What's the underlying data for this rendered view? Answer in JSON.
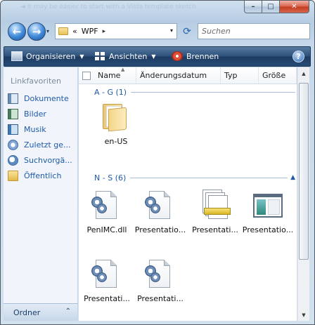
{
  "window": {
    "title_faint": "◄ It may be easier to start with a Vista template sketch",
    "caption": {
      "minimize": "–",
      "maximize": "□",
      "close": "✕"
    }
  },
  "address": {
    "crumb_prefix": "«",
    "path": "WPF",
    "separator": "▸",
    "dropdown": "▾",
    "search_placeholder": "Suchen"
  },
  "nav_buttons": {
    "back": "←",
    "forward": "→",
    "history": "▾"
  },
  "toolbar": {
    "organize": "Organisieren",
    "views": "Ansichten",
    "burn": "Brennen",
    "dropdown_arrow": "▼",
    "help": "?"
  },
  "navpane": {
    "heading": "Linkfavoriten",
    "items": [
      {
        "label": "Dokumente",
        "icon": "documents-icon"
      },
      {
        "label": "Bilder",
        "icon": "pictures-icon"
      },
      {
        "label": "Musik",
        "icon": "music-icon"
      },
      {
        "label": "Zuletzt ge...",
        "icon": "recent-icon"
      },
      {
        "label": "Suchvorgä...",
        "icon": "searches-icon"
      },
      {
        "label": "Öffentlich",
        "icon": "public-folder-icon"
      }
    ],
    "folders_label": "Ordner",
    "folders_chevron": "⌃"
  },
  "columns": {
    "name": "Name",
    "date": "Änderungsdatum",
    "type": "Typ",
    "size": "Größe",
    "sort_caret": "▲"
  },
  "groups": [
    {
      "title": "A - G (1)",
      "items": [
        {
          "label": "en-US",
          "icon": "folder-icon"
        }
      ]
    },
    {
      "title": "N - S (6)",
      "chevron": "▲",
      "items": [
        {
          "label": "PenIMC.dll",
          "icon": "dll-file-icon"
        },
        {
          "label": "Presentatio...",
          "icon": "dll-file-icon"
        },
        {
          "label": "Presentati...",
          "icon": "stacked-documents-icon"
        },
        {
          "label": "Presentatio...",
          "icon": "application-window-icon"
        },
        {
          "label": "Presentati...",
          "icon": "dll-file-icon"
        },
        {
          "label": "Presentati...",
          "icon": "dll-file-icon"
        }
      ]
    }
  ],
  "scrollbar": {
    "up": "▲",
    "down": "▼"
  },
  "colors": {
    "link_blue": "#1e5aa8",
    "command_bar": "#2c4f78",
    "nav_background": "#f1f5fb"
  }
}
